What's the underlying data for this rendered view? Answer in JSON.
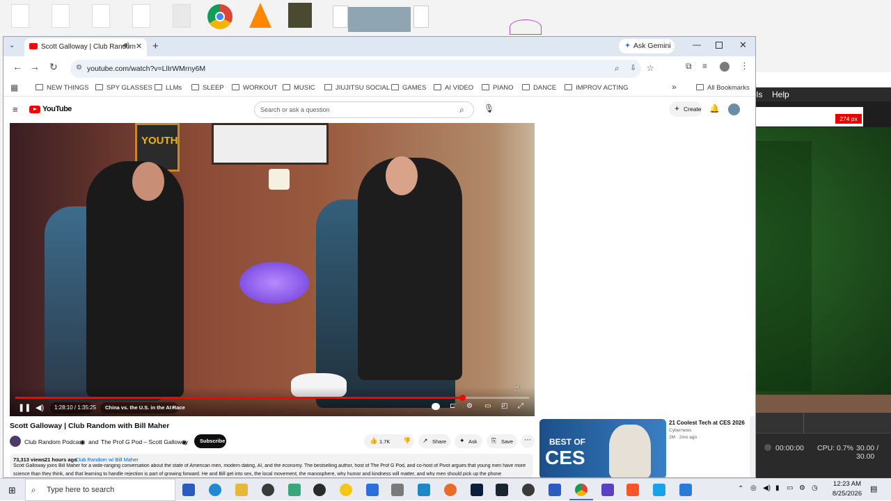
{
  "browser": {
    "tab_title": "Scott Galloway | Club Random",
    "url": "youtube.com/watch?v=LlIrWMrny6M",
    "ask_gemini": "Ask Gemini",
    "bookmarks": [
      "NEW THINGS",
      "SPY GLASSES",
      "LLMs",
      "SLEEP",
      "WORKOUT",
      "MUSIC",
      "JIUJITSU SOCIAL",
      "GAMES",
      "AI VIDEO",
      "PIANO",
      "DANCE",
      "IMPROV ACTING"
    ],
    "all_bookmarks": "All Bookmarks"
  },
  "youtube": {
    "logo_text": "YouTube",
    "search_placeholder": "Search or ask a question",
    "create_label": "Create",
    "video": {
      "time": "1:28:10 / 1:35:25",
      "chapter": "China vs. the U.S. in the AI Race",
      "chapter_arrow": "›",
      "progress": 0.87,
      "poster_text": "YOUTH"
    },
    "title": "Scott Galloway | Club Random with Bill Maher",
    "channel": "Club Random Podcast",
    "channel_and": "and",
    "channel2": "The Prof G Pod – Scott Galloway",
    "subscribe": "Subscribe",
    "likes": "1.7K",
    "share": "Share",
    "ask": "Ask",
    "save": "Save",
    "views": "73,313 views",
    "posted": "21 hours ago",
    "hashtag": "Club Random w/ Bill Maher",
    "description": "Scott Galloway joins Bill Maher for a wide-ranging conversation about the state of American men, modern dating, AI, and the economy. The bestselling author, host of The Prof G Pod, and co-host of Pivot argues that young men have more",
    "description2": "science than they think, and that learning to handle rejection is part of growing forward. He and Bill get into sex, the local movement, the manosphere, why humor and kindness will matter, and why men should pick up the phone",
    "recommended": {
      "title": "21 Coolest Tech at CES 2026",
      "channel": "Cybernews",
      "stats": "2M · 2mo ago",
      "thumb_text_1": "BEST OF",
      "thumb_text_2": "CES"
    }
  },
  "background_apps": {
    "menu_fragment": "ols",
    "help": "Help",
    "size_badge": "274 px",
    "obs_time": "00:00:00",
    "obs_cpu": "CPU: 0.7%",
    "obs_fps": "30.00 / 30.00"
  },
  "taskbar": {
    "search_placeholder": "Type here to search",
    "time": "12:23 AM",
    "date": "8/25/2026"
  },
  "colors": {
    "youtube_red": "#ff0000",
    "chrome_tab_bg": "#dfe7f3",
    "subscribe_bg": "#0f0f0f",
    "webcam_green": "#1f4f1d"
  }
}
